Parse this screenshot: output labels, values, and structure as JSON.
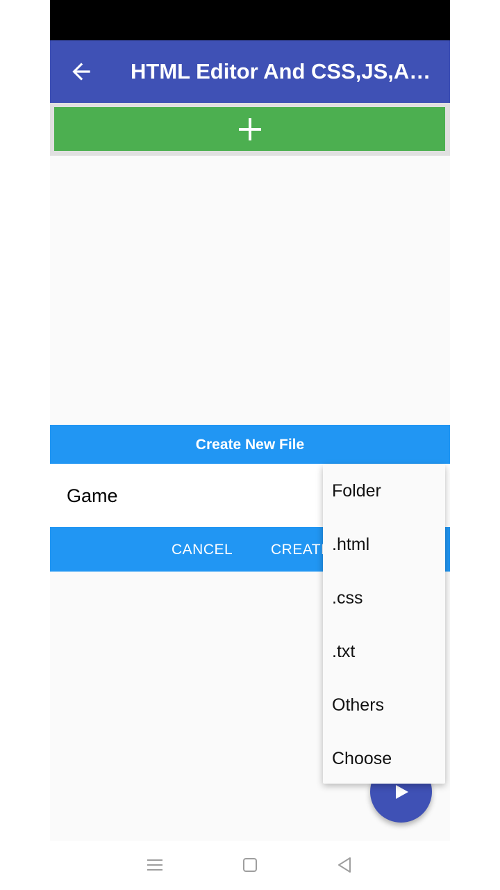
{
  "app_bar": {
    "title": "HTML Editor And CSS,JS,All Language",
    "back_icon": "arrow-back-icon",
    "color": "#3f51b5"
  },
  "add_button": {
    "icon": "plus-icon",
    "color": "#4caf50"
  },
  "dialog": {
    "title": "Create New File",
    "filename_value": "Game",
    "cancel_label": "CANCEL",
    "create_label": "CREATE",
    "accent_color": "#2196f3"
  },
  "dropdown": {
    "options": [
      "Folder",
      ".html",
      ".css",
      ".txt",
      "Others",
      "Choose"
    ]
  },
  "fab": {
    "icon": "play-icon",
    "color": "#3f51b5"
  },
  "nav_bar": {
    "icons": [
      "menu-icon",
      "home-square-icon",
      "back-triangle-icon"
    ]
  }
}
